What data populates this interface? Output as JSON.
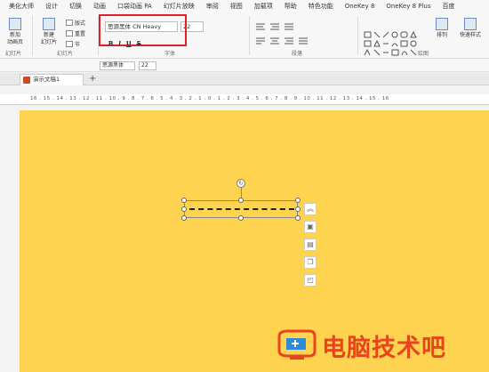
{
  "menu": {
    "items": [
      "美化大师",
      "设计",
      "切换",
      "动画",
      "口袋动画 PA",
      "幻灯片放映",
      "审阅",
      "视图",
      "加载项",
      "帮助",
      "特色功能",
      "OneKey 8",
      "OneKey 8 Plus",
      "百度"
    ]
  },
  "ribbon": {
    "new_slide": "新加\n动画页",
    "new_slide2": "新建\n幻灯片",
    "layout": "版式",
    "reset": "重置",
    "section": "节",
    "font_name": "思源黑体 CN Heavy",
    "font_size": "22",
    "bold": "B",
    "italic": "I",
    "underline": "U",
    "strike": "S",
    "arrange": "排列",
    "quick_styles": "快速样式",
    "group_slides_a": "幻灯片",
    "group_slides_b": "幻灯片",
    "group_font": "字体",
    "group_paragraph": "段落",
    "group_drawing": "绘图"
  },
  "toolbar2": {
    "font_name": "思源黑体",
    "font_size": "22"
  },
  "tabs": {
    "doc_title": "演示文稿1",
    "add": "+"
  },
  "ruler": {
    "marks": "16 . 15 . 14 . 13 . 12 . 11 . 10 . 9 . 8 . 7 . 6 . 5 . 4 . 3 . 2 . 1 . 0 . 1 . 2 . 3 . 4 . 5 . 6 . 7 . 8 . 9 . 10 . 11 . 12 . 13 . 14 . 15 . 16"
  },
  "watermark": {
    "text": "电脑技术吧"
  },
  "colors": {
    "slide_bg": "#fdd34f",
    "highlight": "#e0202a",
    "watermark": "#e8451e"
  }
}
